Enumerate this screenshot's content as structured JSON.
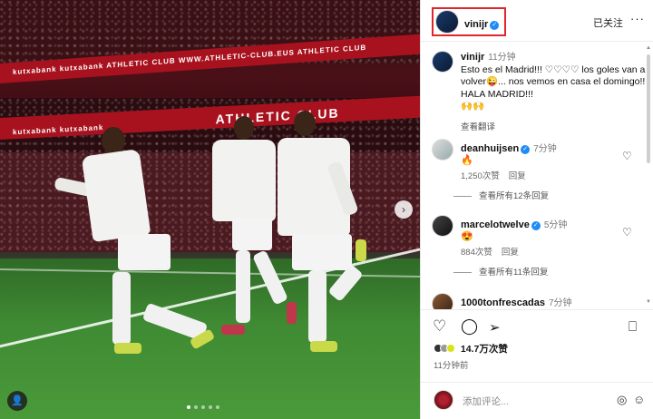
{
  "photo": {
    "banner_top": "kutxabank   kutxabank   ATHLETIC CLUB   WWW.ATHLETIC-CLUB.EUS   ATHLETIC CLUB",
    "banner_mid_small": "kutxabank   kutxabank",
    "banner_mid_big": "ATHLETIC CLUB",
    "next_arrow": "›",
    "user_tag_icon": "person-icon"
  },
  "header": {
    "username": "vinijr",
    "follow_label": "已关注",
    "more_label": "···"
  },
  "caption": {
    "username": "vinijr",
    "time": "11分钟",
    "text": "Esto es el Madrid!!! ♡♡♡♡ los goles van a volver😜... nos vemos en casa el domingo!! HALA MADRID!!!",
    "hands": "🙌🙌",
    "see_translation": "查看翻译"
  },
  "comments": [
    {
      "username": "deanhuijsen",
      "verified": true,
      "time": "7分钟",
      "emoji": "🔥",
      "likes": "1,250次赞",
      "reply": "回复",
      "view_replies": "查看所有12条回复"
    },
    {
      "username": "marcelotwelve",
      "verified": true,
      "time": "5分钟",
      "emoji": "😍",
      "likes": "884次赞",
      "reply": "回复",
      "view_replies": "查看所有11条回复"
    },
    {
      "username": "1000tonfrescadas",
      "verified": false,
      "time": "7分钟"
    }
  ],
  "actions": {
    "likes_label": "14.7万次赞",
    "post_time": "11分钟前"
  },
  "add_comment": {
    "placeholder": "添加评论..."
  },
  "colors": {
    "highlight_box": "#e0252b",
    "verified": "#1f8bf5"
  }
}
